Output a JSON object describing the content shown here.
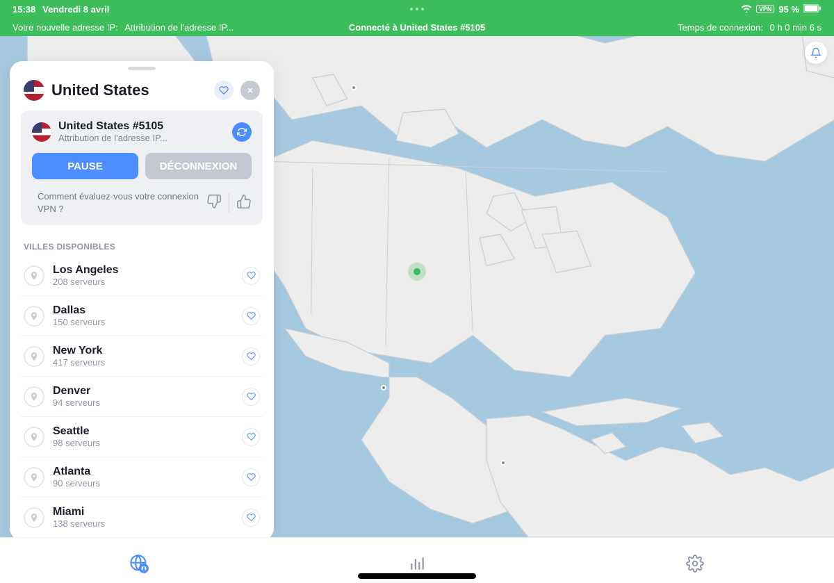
{
  "status": {
    "time": "15:38",
    "date": "Vendredi 8 avril",
    "battery": "95 %",
    "vpn_label": "VPN"
  },
  "info": {
    "ip_label": "Votre nouvelle adresse IP:",
    "ip_status": "Attribution de l'adresse IP...",
    "center": "Connecté à United States #5105",
    "duration_label": "Temps de connexion:",
    "duration": "0 h 0 min 6 s"
  },
  "panel": {
    "title": "United States",
    "conn_name": "United States #5105",
    "conn_sub": "Attribution de l'adresse IP...",
    "pause": "PAUSE",
    "disconnect": "DÉCONNEXION",
    "rating_prompt": "Comment évaluez-vous votre connexion VPN ?",
    "section": "VILLES DISPONIBLES"
  },
  "cities": [
    {
      "name": "Los Angeles",
      "servers": "208 serveurs"
    },
    {
      "name": "Dallas",
      "servers": "150 serveurs"
    },
    {
      "name": "New York",
      "servers": "417 serveurs"
    },
    {
      "name": "Denver",
      "servers": "94 serveurs"
    },
    {
      "name": "Seattle",
      "servers": "98 serveurs"
    },
    {
      "name": "Atlanta",
      "servers": "90 serveurs"
    },
    {
      "name": "Miami",
      "servers": "138 serveurs"
    }
  ]
}
